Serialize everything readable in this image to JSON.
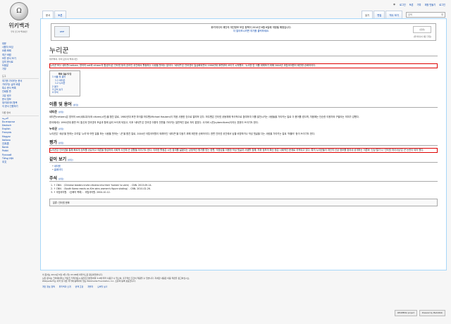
{
  "logo": {
    "globe_char": "Ω",
    "name": "위키백과",
    "tagline": "우리 모두의 백과사전"
  },
  "personal": {
    "user_icon": "user-icon",
    "items": [
      "로그인",
      "토론",
      "기여",
      "계정 만들기",
      "로그인"
    ]
  },
  "tabs_left": [
    "문서",
    "토론"
  ],
  "tabs_right": [
    "읽기",
    "편집",
    "역사 보기"
  ],
  "search": {
    "placeholder": "검색"
  },
  "sidebar": {
    "sections": [
      {
        "heading": "",
        "items": [
          "대문",
          "사용자 모임",
          "요즘 화제",
          "최근 바뀜",
          "모든 문서 보기",
          "임의 문서로",
          "도움말",
          "기부"
        ]
      },
      {
        "heading": "도구",
        "items": [
          "여기를 가리키는 문서",
          "가리키는 글의 바뀜",
          "특수 문서 목록",
          "인쇄용 판",
          "고유 링크",
          "문서 정보",
          "위키데이터 항목",
          "이 문서 인용하기"
        ]
      },
      {
        "heading": "다른 언어",
        "items": [
          "العربية",
          "Български",
          "Deutsch",
          "English",
          "Français",
          "Magyar",
          "Italiano",
          "日本語",
          "Norsk",
          "Polski",
          "Русский",
          "Tiếng Việt",
          "中文"
        ]
      }
    ]
  },
  "notice": {
    "wmf_logo": "WMF",
    "line1": "위키미디어 재단의 개인정보 보호 정책이 2014년 6월 6일에 개정될 예정입니다.",
    "line2": "더 알아보시려면 여기를 클릭하세요.",
    "meta": "[위키미디어 재단 알림]",
    "right": "[닫기]"
  },
  "article": {
    "title": "누리꾼",
    "sitesub": "위키백과, 우리 모두의 백과사전.",
    "intro": "누리꾼 또는 네티즌(netizen, 영어의 net와 citizen의 합성어)은 인터넷 등의 온라인 공간에서 활동하는 사람을 뜻하는 말이다. '네티즌'은 인터넷이 일상화되면서 1990년대 후반부터 쓰이기 시작했고, '누리꾼'은 이를 대체하기 위해 2004년 국립국어원이 제안한 순화어이다.",
    "toc": {
      "title": "목차 [숨기기]",
      "items": [
        "1 이름 및 용어",
        "1.1 네티즌",
        "1.2 누리꾼",
        "2 평가",
        "3 같이 보기",
        "4 주석"
      ]
    },
    "s1_title": "이름 및 용어",
    "edit": "[편집]",
    "s1a_title": "네티즌",
    "s1a_p1": "네티즌(netizen)은 영어의 net(네트워크)와 citizen(시민)을 합친 말로, 1980년대 후반 마이클 하우벤(Michael Hauben)이 처음 사용한 것으로 알려져 있다. 하우벤은 인터넷 공동체에 적극적으로 참여하여 이를 발전시키는 사람들을 가리키는 말로 이 용어를 썼으며, 처음에는 단순한 이용자와 구별되는 의미가 강했다.",
    "s1a_p2": "한국에서는 1990년대 중반 PC 통신과 인터넷의 보급과 함께 널리 쓰이게 되었고, 이후 '네티즌'은 인터넷 이용자 전반을 가리키는 일반적인 말로 자리 잡았다. 사이버 시민(cybercitizen)이라는 표현이 쓰이기도 한다.",
    "s1b_title": "누리꾼",
    "s1b_p1": "누리꾼은 '세상'을 뜻하는 우리말 '누리'와 어떤 일을 하는 사람을 뜻하는 '-꾼'을 합친 말로, 2004년 국립국어원이 외래어인 '네티즌'을 다듬기 위해 제안한 순화어이다. 한편 인터넷 공간에서 남을 비방하거나 악성 댓글을 다는 사람을 가리키는 말로 '악플러' 등이 쓰이기도 한다.",
    "s2_title": "평가",
    "s2_p1": "누리꾼은 인터넷을 통해 빠르게 정보를 공유하고 여론을 형성하여 사회적 사건에 큰 영향을 미치기도 한다. 이러한 활동은 시민 참여를 넓혔다는 긍정적인 평가를 받는 한편, 익명성을 이용한 악성 댓글과 사생활 침해, 허위 정보의 확산 등은 사회적인 문제로 지적되고 있다. 특히 누리꾼들이 개인의 신상 정보를 찾아내 공개하는 이른바 '신상 털기'나 '인터넷 마녀사냥'은 큰 논란이 되어 왔다.",
    "s3_title": "같이 보기",
    "see_also": [
      "네티켓",
      "홈페이지"
    ],
    "s4_title": "주석",
    "refs": [
      "↑ CNN. 〈Chinese leaders invite citizens into their 'homes' to vent〉. CNN. 2013-09-14.",
      "↑ CNN. 〈South Korea reacts as Kim wins women's figure skating〉. CNN. 2010-02-26.",
      "↑ 국립국어원. 〈순화어 목록〉. 국립국어원. 2004-10-12."
    ],
    "category": "분류: 인터넷 문화"
  },
  "footer": {
    "line1": "이 문서는 2014년 5월 4일 (일) 03:06에 마지막으로 편집되었습니다.",
    "line2": "모든 문서는 크리에이티브 커먼즈 저작자표시-동일조건변경허락 3.0에 따라 사용할 수 있으며, 추가적인 조건이 적용될 수 있습니다. 자세한 내용은 이용 약관을 참고하십시오.",
    "line3": "Wikipedia®는 미국 및 다른 국가에 등록되어 있는 Wikimedia Foundation, Inc. 소유의 등록 상표입니다.",
    "places": [
      "개인 정보 정책",
      "위키백과 소개",
      "면책 조항",
      "개발자",
      "모바일 보기"
    ],
    "icons": [
      "WIKIMEDIA project",
      "Powered by MediaWiki"
    ]
  }
}
